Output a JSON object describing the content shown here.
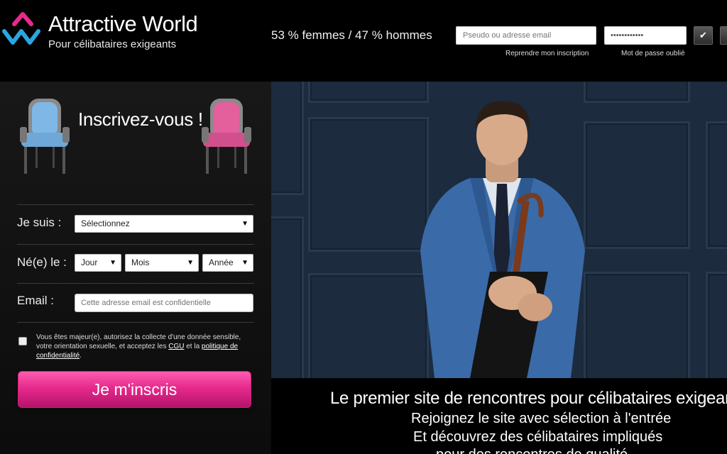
{
  "header": {
    "brand": "Attractive World",
    "tagline": "Pour célibataires exigeants",
    "ratio": "53 % femmes / 47 % hommes",
    "login": {
      "username_placeholder": "Pseudo ou adresse email",
      "password_value": "••••••••••••",
      "submit_icon": "✔",
      "resume_link": "Reprendre mon inscription",
      "forgot_link": "Mot de passe oublié"
    }
  },
  "signup": {
    "title": "Inscrivez-vous !",
    "gender_label": "Je suis :",
    "gender_value": "Sélectionnez",
    "birth_label": "Né(e) le :",
    "day_value": "Jour",
    "month_value": "Mois",
    "year_value": "Année",
    "email_label": "Email :",
    "email_placeholder": "Cette adresse email est confidentielle",
    "consent_part1": "Vous êtes majeur(e), autorisez la collecte d'une donnée sensible, votre orientation sexuelle, et acceptez les ",
    "consent_cgu": "CGU",
    "consent_part2": " et la ",
    "consent_policy": "politique de confidentialité",
    "consent_end": ".",
    "submit_label": "Je m'inscris"
  },
  "hero": {
    "headline": "Le premier site de rencontres pour célibataires exigeants",
    "line1": "Rejoignez le site avec sélection à l'entrée",
    "line2": "Et découvrez des célibataires impliqués",
    "line3": "pour des rencontres de qualité"
  },
  "colors": {
    "accent_pink": "#e62a8c",
    "accent_blue": "#2aa6e0",
    "hero_bg": "#1c2b3d"
  }
}
